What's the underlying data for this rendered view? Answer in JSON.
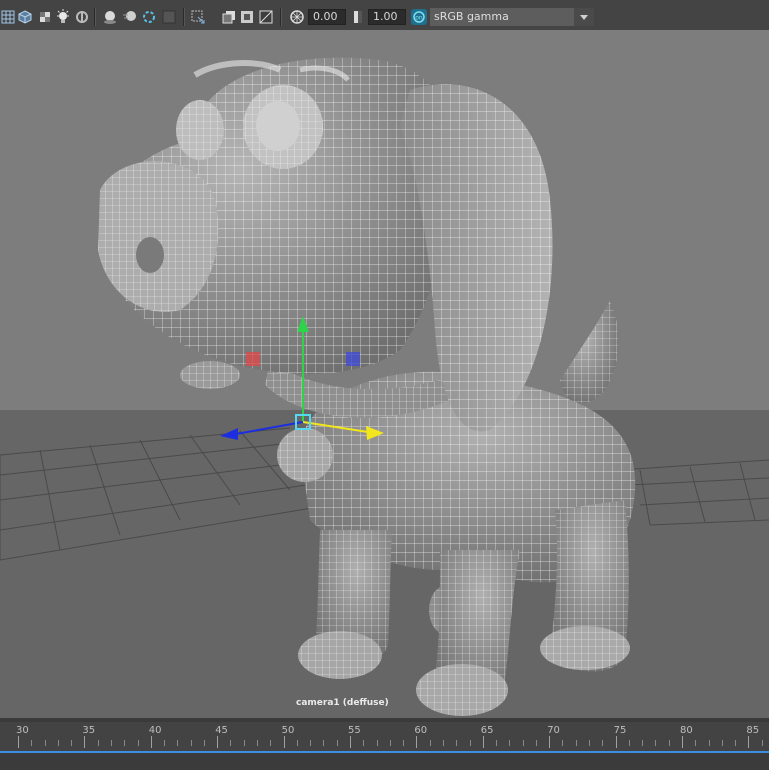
{
  "toolbar": {
    "icons": [
      "grid-icon",
      "wireframe-cube-icon",
      "checker-cube-icon",
      "light-bulb-icon",
      "shadow-icon",
      "ambient-occlusion-icon",
      "motion-blur-icon",
      "anti-alias-icon",
      "isolate-select-icon",
      "xray-icon",
      "xray-joints-icon",
      "xray-component-icon",
      "exposure-icon",
      "gamma-icon",
      "color-management-icon"
    ],
    "exposure_value": "0.00",
    "gamma_value": "1.00",
    "color_space": "sRGB gamma"
  },
  "viewport": {
    "camera_label": "camera1 (deffuse)",
    "colors": {
      "background_top": "#7d7d7d",
      "background_floor": "#666666",
      "mesh": "#9a9a9a",
      "wire": "#ffffff"
    }
  },
  "timeline": {
    "ticks": [
      "30",
      "35",
      "40",
      "45",
      "50",
      "55",
      "60",
      "65",
      "70",
      "75",
      "80",
      "85"
    ],
    "accent": "#3a8ee6"
  }
}
